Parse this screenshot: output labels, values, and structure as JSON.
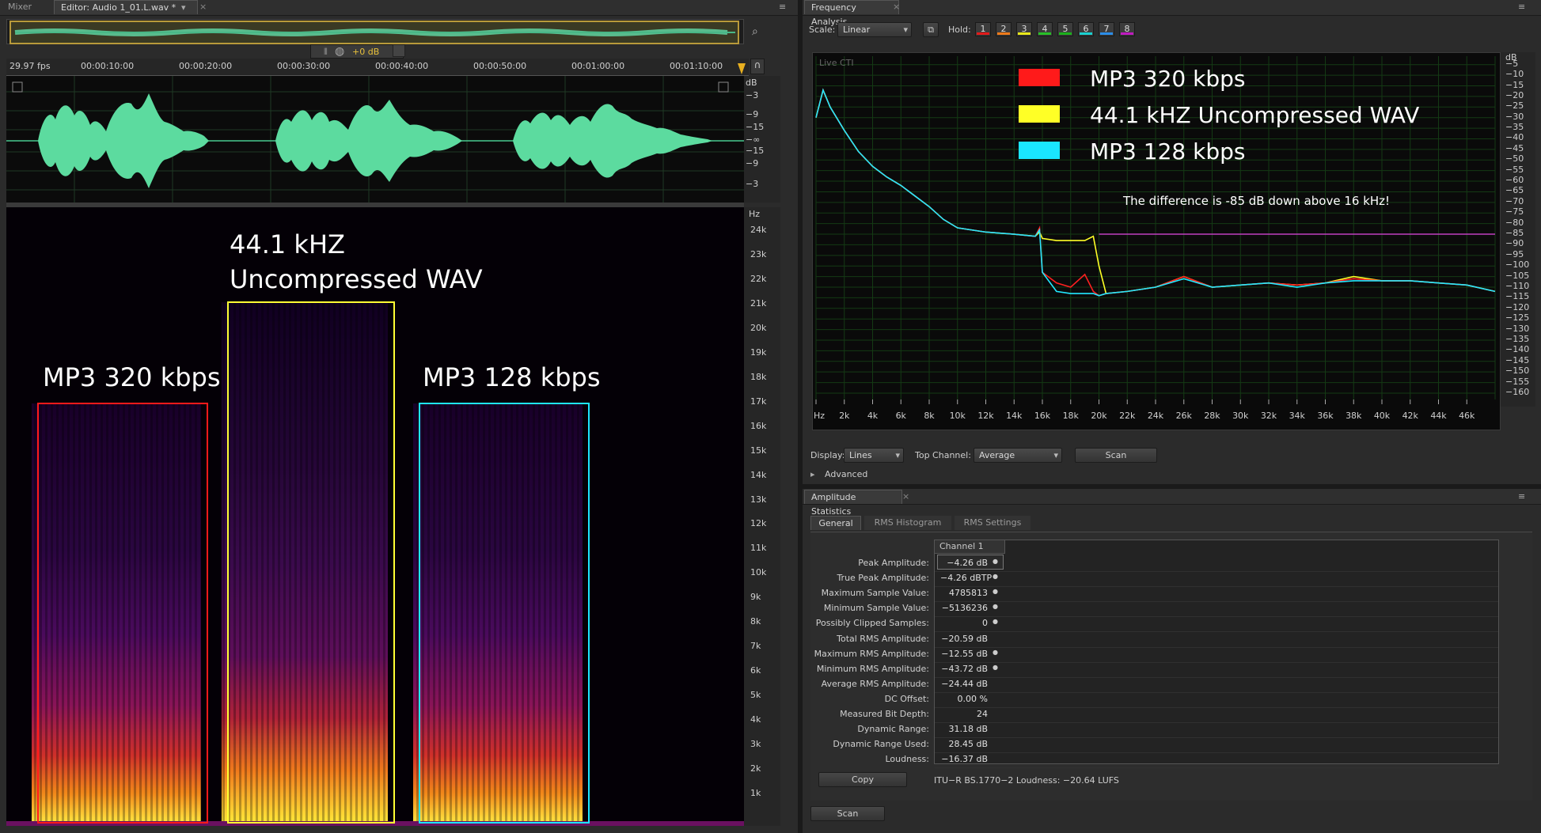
{
  "tabs": {
    "mixer": "Mixer",
    "editor": "Editor: Audio 1_01.L.wav *"
  },
  "transport": {
    "volume": "+0 dB"
  },
  "timeline": {
    "fps": "29.97 fps",
    "ticks": [
      "00:00:10:00",
      "00:00:20:00",
      "00:00:30:00",
      "00:00:40:00",
      "00:00:50:00",
      "00:01:00:00",
      "00:01:10:00"
    ]
  },
  "waveform": {
    "db_unit": "dB",
    "db_ticks": [
      "−3",
      "−9",
      "−15",
      "−∞",
      "−15",
      "−9",
      "−3"
    ]
  },
  "spectral": {
    "hz_unit": "Hz",
    "hz_ticks": [
      "24k",
      "23k",
      "22k",
      "21k",
      "20k",
      "19k",
      "18k",
      "17k",
      "16k",
      "15k",
      "14k",
      "13k",
      "12k",
      "11k",
      "10k",
      "9k",
      "8k",
      "7k",
      "6k",
      "5k",
      "4k",
      "3k",
      "2k",
      "1k"
    ],
    "labels": {
      "mp3_320": "MP3 320 kbps",
      "wav_line1": "44.1 kHZ",
      "wav_line2": "Uncompressed WAV",
      "mp3_128": "MP3 128 kbps"
    },
    "colors": {
      "mp3_320": "#ff1a1a",
      "wav": "#ffff33",
      "mp3_128": "#1ee6ff"
    }
  },
  "frequency_analysis": {
    "title": "Frequency Analysis",
    "scale_label": "Scale:",
    "scale_value": "Linear",
    "hold_label": "Hold:",
    "hold_slots": [
      {
        "n": "1",
        "color": "#e21a1a"
      },
      {
        "n": "2",
        "color": "#ee7a1a"
      },
      {
        "n": "3",
        "color": "#e8e81a"
      },
      {
        "n": "4",
        "color": "#27c027"
      },
      {
        "n": "5",
        "color": "#1ab01a"
      },
      {
        "n": "6",
        "color": "#1ad0d0"
      },
      {
        "n": "7",
        "color": "#2a8de8"
      },
      {
        "n": "8",
        "color": "#c01ac0"
      }
    ],
    "live_cti": "Live CTI",
    "legend": [
      {
        "label": "MP3 320 kbps",
        "color": "#ff1a1a"
      },
      {
        "label": "44.1 kHZ Uncompressed WAV",
        "color": "#ffff26"
      },
      {
        "label": "MP3 128 kbps",
        "color": "#1ae6ff"
      }
    ],
    "annotation": "The difference is -85 dB down above 16 kHz!",
    "db_unit": "dB",
    "db_ticks": [
      "−5",
      "−10",
      "−15",
      "−20",
      "−25",
      "−30",
      "−35",
      "−40",
      "−45",
      "−50",
      "−55",
      "−60",
      "−65",
      "−70",
      "−75",
      "−80",
      "−85",
      "−90",
      "−95",
      "−100",
      "−105",
      "−110",
      "−115",
      "−120",
      "−125",
      "−130",
      "−135",
      "−140",
      "−145",
      "−150",
      "−155",
      "−160"
    ],
    "hz_ticks": [
      "Hz",
      "2k",
      "4k",
      "6k",
      "8k",
      "10k",
      "12k",
      "14k",
      "16k",
      "18k",
      "20k",
      "22k",
      "24k",
      "26k",
      "28k",
      "30k",
      "32k",
      "34k",
      "36k",
      "38k",
      "40k",
      "42k",
      "44k",
      "46k"
    ],
    "display_label": "Display:",
    "display_value": "Lines",
    "top_channel_label": "Top Channel:",
    "top_channel_value": "Average",
    "scan_label": "Scan",
    "advanced_label": "Advanced",
    "chart_data": {
      "type": "line",
      "xlabel": "Hz",
      "ylabel": "dB",
      "xlim": [
        0,
        48000
      ],
      "ylim": [
        -163,
        -1
      ],
      "x": [
        0,
        500,
        1000,
        2000,
        3000,
        4000,
        5000,
        6000,
        7000,
        8000,
        9000,
        10000,
        12000,
        14000,
        15500,
        15800,
        16000,
        17000,
        18000,
        19000,
        19600,
        20000,
        20500,
        22000,
        24000,
        26000,
        28000,
        30000,
        32000,
        34000,
        36000,
        38000,
        40000,
        42000,
        44000,
        46000,
        48000
      ],
      "series": [
        {
          "name": "MP3 320 kbps",
          "color": "#ff2020",
          "values": [
            -30,
            -17,
            -25,
            -36,
            -46,
            -53,
            -58,
            -62,
            -67,
            -72,
            -78,
            -82,
            -84,
            -85,
            -86,
            -82,
            -103,
            -108,
            -110,
            -104,
            -112,
            -114,
            -113,
            -112,
            -110,
            -105,
            -110,
            -109,
            -108,
            -109,
            -108,
            -106,
            -107,
            -107,
            -108,
            -109,
            -112
          ]
        },
        {
          "name": "44.1 kHZ Uncompressed WAV",
          "color": "#ffff26",
          "values": [
            -30,
            -17,
            -25,
            -36,
            -46,
            -53,
            -58,
            -62,
            -67,
            -72,
            -78,
            -82,
            -84,
            -85,
            -86,
            -84,
            -87,
            -88,
            -88,
            -88,
            -86,
            -100,
            -113,
            -112,
            -110,
            -105,
            -110,
            -109,
            -108,
            -109,
            -108,
            -105,
            -107,
            -107,
            -108,
            -109,
            -112
          ]
        },
        {
          "name": "MP3 128 kbps",
          "color": "#22e8ff",
          "values": [
            -30,
            -17,
            -25,
            -36,
            -46,
            -53,
            -58,
            -62,
            -67,
            -72,
            -78,
            -82,
            -84,
            -85,
            -86,
            -83,
            -103,
            -112,
            -113,
            -113,
            -113,
            -114,
            -113,
            -112,
            -110,
            -106,
            -110,
            -109,
            -108,
            -110,
            -108,
            -107,
            -107,
            -107,
            -108,
            -109,
            -112
          ]
        }
      ],
      "reference_line": {
        "y": -85,
        "x_start": 20000,
        "x_end": 48000,
        "color": "#c040c0"
      }
    }
  },
  "amplitude_statistics": {
    "title": "Amplitude Statistics",
    "tabs": [
      "General",
      "RMS Histogram",
      "RMS Settings"
    ],
    "channel_header": "Channel 1",
    "rows": [
      {
        "label": "Peak Amplitude:",
        "value": "−4.26 dB",
        "dot": true
      },
      {
        "label": "True Peak Amplitude:",
        "value": "−4.26 dBTP",
        "dot": true
      },
      {
        "label": "Maximum Sample Value:",
        "value": "4785813",
        "dot": true
      },
      {
        "label": "Minimum Sample Value:",
        "value": "−5136236",
        "dot": true
      },
      {
        "label": "Possibly Clipped Samples:",
        "value": "0",
        "dot": true
      },
      {
        "label": "Total RMS Amplitude:",
        "value": "−20.59 dB",
        "dot": false
      },
      {
        "label": "Maximum RMS Amplitude:",
        "value": "−12.55 dB",
        "dot": true
      },
      {
        "label": "Minimum RMS Amplitude:",
        "value": "−43.72 dB",
        "dot": true
      },
      {
        "label": "Average RMS Amplitude:",
        "value": "−24.44 dB",
        "dot": false
      },
      {
        "label": "DC Offset:",
        "value": "0.00 %",
        "dot": false
      },
      {
        "label": "Measured Bit Depth:",
        "value": "24",
        "dot": false
      },
      {
        "label": "Dynamic Range:",
        "value": "31.18 dB",
        "dot": false
      },
      {
        "label": "Dynamic Range Used:",
        "value": "28.45 dB",
        "dot": false
      },
      {
        "label": "Loudness:",
        "value": "−16.37 dB",
        "dot": false
      }
    ],
    "copy_label": "Copy",
    "loudness_note": "ITU−R BS.1770−2 Loudness: −20.64 LUFS",
    "scan_label": "Scan"
  }
}
